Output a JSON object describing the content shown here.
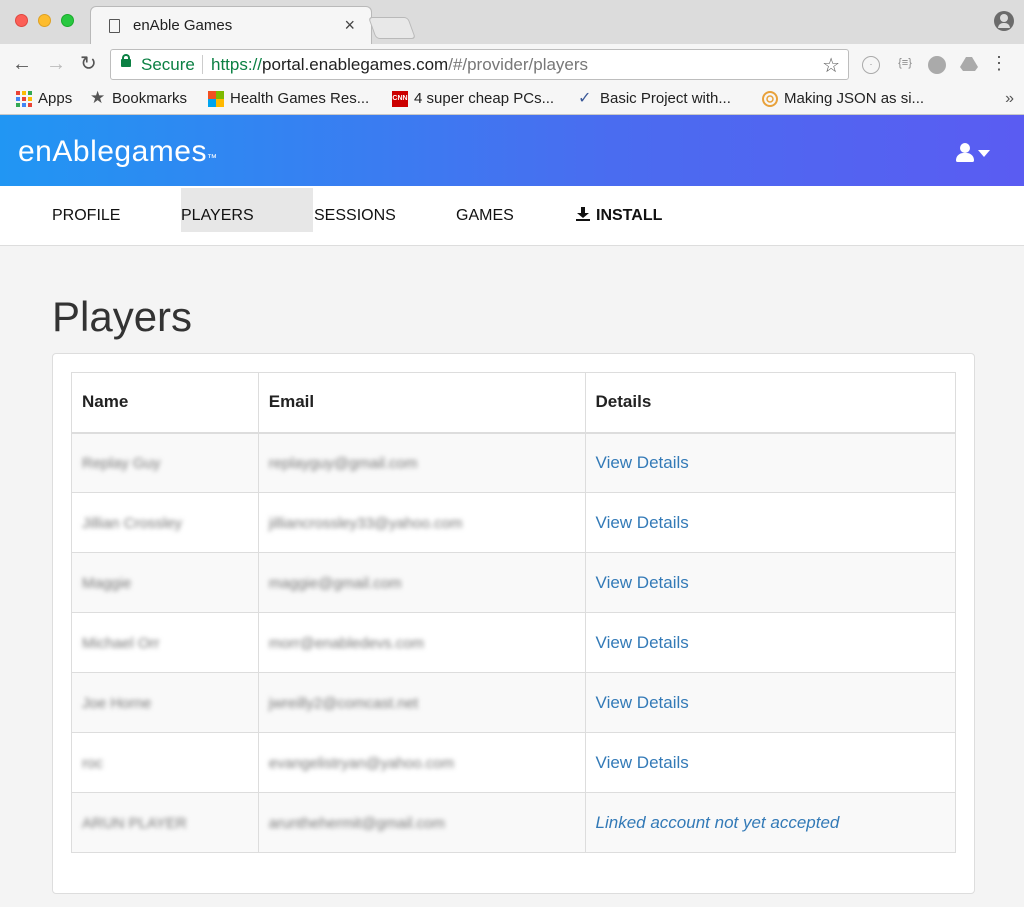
{
  "browser": {
    "tab_title": "enAble Games",
    "tab_close": "×",
    "secure_label": "Secure",
    "url_scheme": "https://",
    "url_host": "portal.enablegames.com",
    "url_path": "/#/provider/players",
    "bookmarks": [
      {
        "label": "Apps",
        "icon": "apps-grid-icon"
      },
      {
        "label": "Bookmarks",
        "icon": "star-icon"
      },
      {
        "label": "Health Games Res...",
        "icon": "windows-logo-icon"
      },
      {
        "label": "4 super cheap PCs...",
        "icon": "cnn-icon"
      },
      {
        "label": "Basic Project with...",
        "icon": "checkmark-icon"
      },
      {
        "label": "Making JSON as si...",
        "icon": "json-logo-icon"
      }
    ],
    "bookmarks_overflow": "»"
  },
  "site": {
    "logo_text": "enAblegames",
    "logo_mark": "™",
    "accent_gradient": [
      "#2196f3",
      "#5a5cf2"
    ],
    "nav": [
      {
        "label": "PROFILE",
        "active": false
      },
      {
        "label": "PLAYERS",
        "active": true
      },
      {
        "label": "SESSIONS",
        "active": false
      },
      {
        "label": "GAMES",
        "active": false
      },
      {
        "label": "INSTALL",
        "active": false,
        "icon": "download-icon"
      }
    ]
  },
  "main": {
    "title": "Players",
    "table": {
      "headers": [
        "Name",
        "Email",
        "Details"
      ],
      "rows": [
        {
          "name": "Replay Guy",
          "email": "replayguy@gmail.com",
          "details": "View Details"
        },
        {
          "name": "Jillian Crossley",
          "email": "jilliancrossley33@yahoo.com",
          "details": "View Details"
        },
        {
          "name": "Maggie",
          "email": "maggie@gmail.com",
          "details": "View Details"
        },
        {
          "name": "Michael Orr",
          "email": "morr@enabledevs.com",
          "details": "View Details"
        },
        {
          "name": "Joe Horne",
          "email": "jwreilly2@comcast.net",
          "details": "View Details"
        },
        {
          "name": "roc",
          "email": "evangelistryan@yahoo.com",
          "details": "View Details"
        },
        {
          "name": "ARUN PLAYER",
          "email": "arunthehermit@gmail.com",
          "details": "Linked account not yet accepted"
        }
      ]
    }
  }
}
